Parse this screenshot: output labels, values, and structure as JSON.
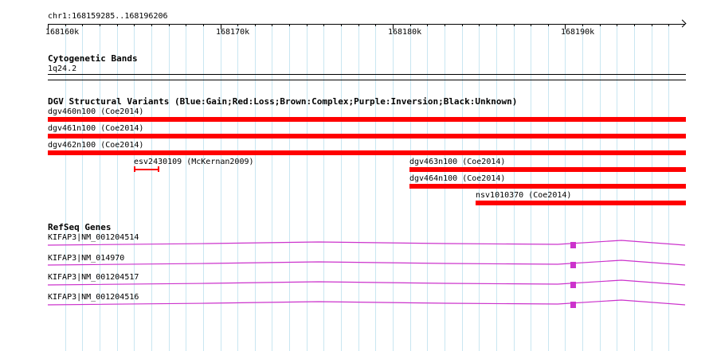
{
  "ruler": {
    "location": "chr1:168159285..168196206",
    "ticks": [
      "168160k",
      "168170k",
      "168180k",
      "168190k"
    ]
  },
  "cytoband": {
    "title": "Cytogenetic Bands",
    "band": "1q24.2"
  },
  "dgv": {
    "title": "DGV Structural Variants (Blue:Gain;Red:Loss;Brown:Complex;Purple:Inversion;Black:Unknown)",
    "color": "#ff0000",
    "features": [
      {
        "label": "dgv460n100 (Coe2014)"
      },
      {
        "label": "dgv461n100 (Coe2014)"
      },
      {
        "label": "dgv462n100 (Coe2014)"
      },
      {
        "label": "esv2430109 (McKernan2009)"
      },
      {
        "label": "dgv463n100 (Coe2014)"
      },
      {
        "label": "dgv464n100 (Coe2014)"
      },
      {
        "label": "nsv1010370 (Coe2014)"
      }
    ]
  },
  "refseq": {
    "title": "RefSeq Genes",
    "color": "#cc33cc",
    "transcripts": [
      {
        "label": "KIFAP3|NM_001204514"
      },
      {
        "label": "KIFAP3|NM_014970"
      },
      {
        "label": "KIFAP3|NM_001204517"
      },
      {
        "label": "KIFAP3|NM_001204516"
      }
    ]
  }
}
